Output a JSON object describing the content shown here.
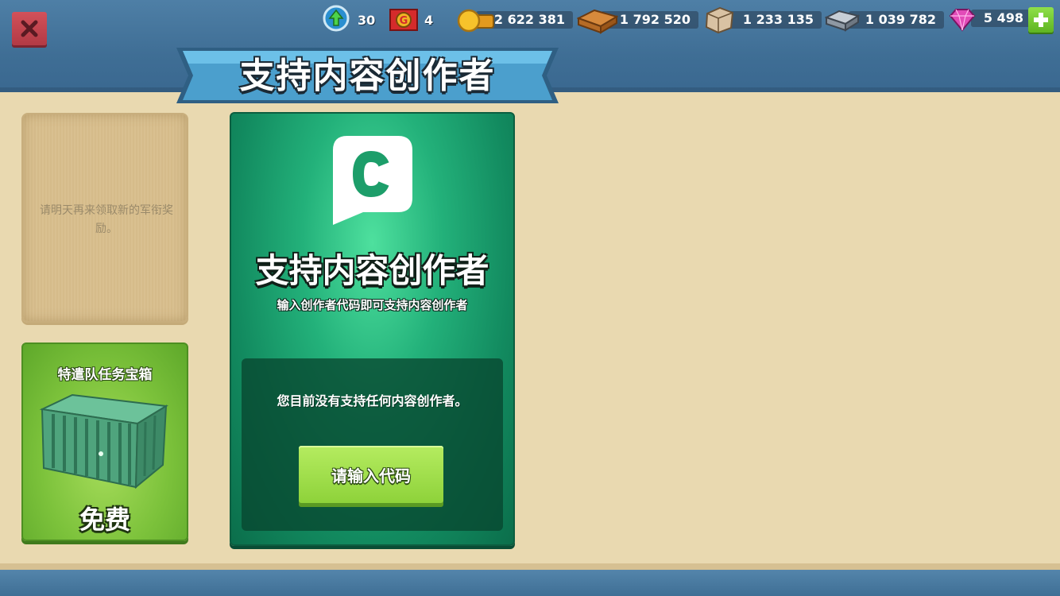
{
  "header": {
    "close_icon": "close-icon",
    "resources": {
      "xp": {
        "icon": "xp-level-icon",
        "value": "30"
      },
      "rank": {
        "icon": "rank-badge-icon",
        "value": "4"
      },
      "gold": {
        "icon": "gold-coin-icon",
        "value": "2 622 381"
      },
      "wood": {
        "icon": "wood-planks-icon",
        "value": "1 792 520"
      },
      "stone": {
        "icon": "stone-block-icon",
        "value": "1 233 135"
      },
      "iron": {
        "icon": "iron-ingot-icon",
        "value": "1 039 782"
      },
      "gems": {
        "icon": "gem-icon",
        "value": "5 498"
      }
    },
    "add_gems_icon": "plus-icon"
  },
  "banner": {
    "title": "支持内容创作者"
  },
  "reward_card": {
    "text": "请明天再来领取新的军衔奖励。"
  },
  "crate_card": {
    "title": "特遣队任务宝箱",
    "price": "免费",
    "icon": "cargo-crate-icon"
  },
  "creator_panel": {
    "logo_icon": "creator-c-logo-icon",
    "title": "支持内容创作者",
    "subtitle": "输入创作者代码即可支持内容创作者",
    "status": "您目前没有支持任何内容创作者。",
    "button_label": "请输入代码"
  },
  "colors": {
    "sky_blue": "#4e7fa6",
    "sand": "#e9d9b0",
    "panel_green": "#23b17a",
    "button_green": "#9ad93f",
    "close_red": "#c9444f"
  }
}
